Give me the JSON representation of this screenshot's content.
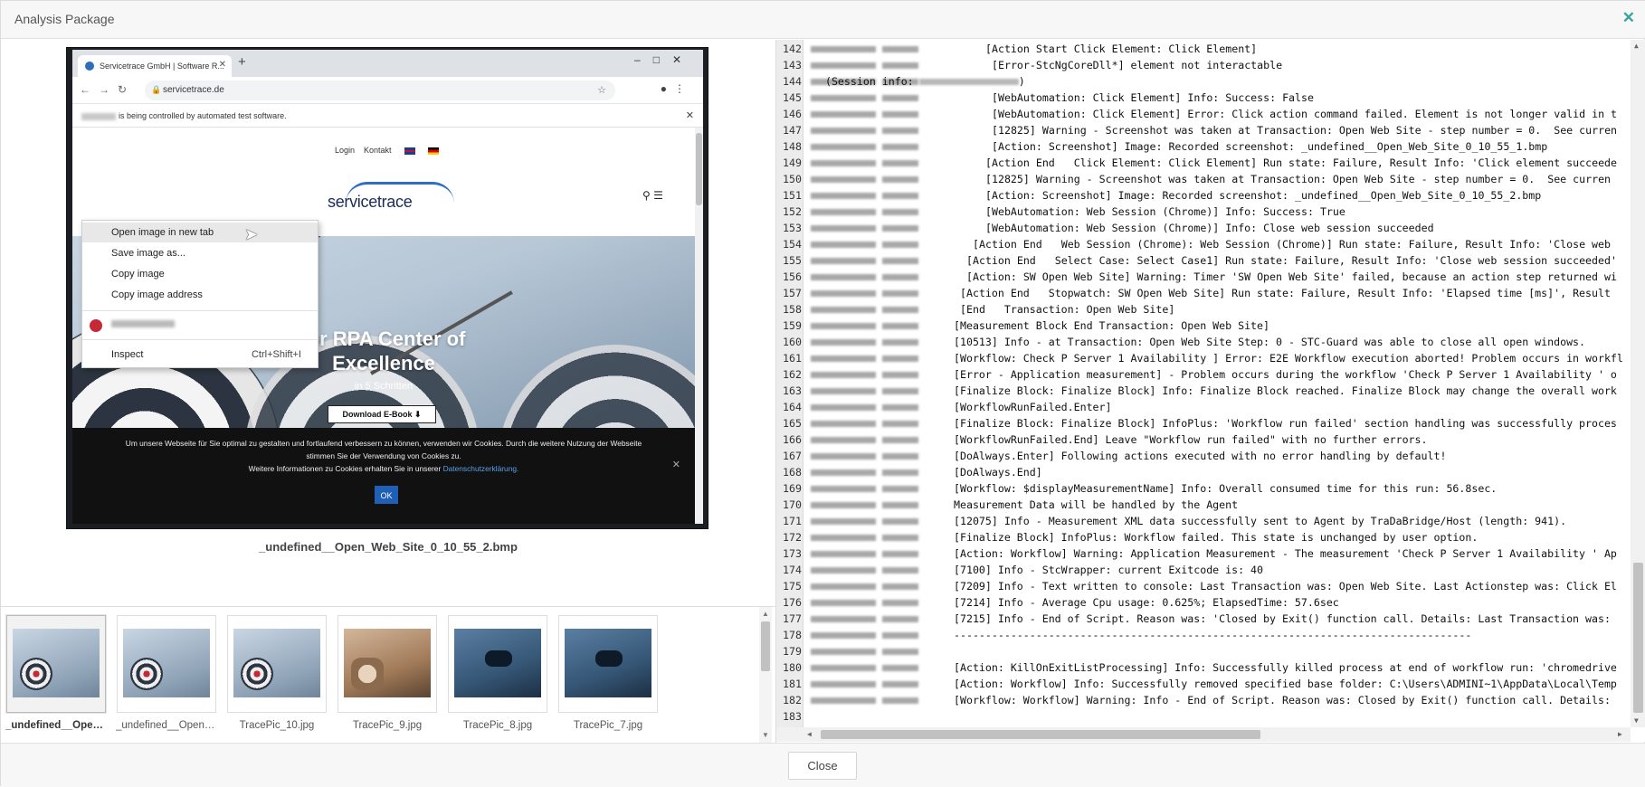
{
  "dialog": {
    "title": "Analysis Package",
    "close_icon": "close-icon",
    "close_button": "Close"
  },
  "preview": {
    "caption": "_undefined__Open_Web_Site_0_10_55_2.bmp",
    "browser": {
      "tab_title": "Servicetrace GmbH | Software R...",
      "url": "servicetrace.de",
      "automation_notice": "is being controlled by automated test software.",
      "site_nav": [
        "Login",
        "Kontakt"
      ],
      "logo": "servicetrace",
      "hero_title_1": "Ihr RPA Center of",
      "hero_title_2": "Excellence",
      "hero_sub": "in 5 Schritten",
      "hero_button": "Download E-Book",
      "cookie_text_1": "Um unsere Webseite für Sie optimal zu gestalten und fortlaufend verbessern zu können, verwenden wir Cookies. Durch die weitere Nutzung der Webseite",
      "cookie_text_2": "stimmen Sie der Verwendung von Cookies zu.",
      "cookie_text_3": "Weitere Informationen zu Cookies erhalten Sie in unserer",
      "cookie_link": "Datenschutzerklärung.",
      "cookie_ok": "OK"
    },
    "context_menu": {
      "items": [
        "Open image in new tab",
        "Save image as...",
        "Copy image",
        "Copy image address"
      ],
      "inspect": "Inspect",
      "inspect_shortcut": "Ctrl+Shift+I"
    }
  },
  "thumbnails": [
    {
      "label": "_undefined__Open_...",
      "style": "target",
      "selected": true
    },
    {
      "label": "_undefined__Open_...",
      "style": "target",
      "selected": false
    },
    {
      "label": "TracePic_10.jpg",
      "style": "target",
      "selected": false
    },
    {
      "label": "TracePic_9.jpg",
      "style": "alt",
      "selected": false
    },
    {
      "label": "TracePic_8.jpg",
      "style": "vr",
      "selected": false
    },
    {
      "label": "TracePic_7.jpg",
      "style": "vr",
      "selected": false
    }
  ],
  "log": {
    "lines": [
      {
        "n": "142",
        "indent": 20,
        "text": "[Action Start Click Element: Click Element]"
      },
      {
        "n": "143",
        "indent": 21,
        "text": "[Error-StcNgCoreDll*] element not interactable"
      },
      {
        "n": "144",
        "indent": 0,
        "text": "  (Session info:",
        "session_blur": true
      },
      {
        "n": "145",
        "indent": 21,
        "text": "[WebAutomation: Click Element] Info: Success: False"
      },
      {
        "n": "146",
        "indent": 21,
        "text": "[WebAutomation: Click Element] Error: Click action command failed. Element is not longer valid in t"
      },
      {
        "n": "147",
        "indent": 21,
        "text": "[12825] Warning - Screenshot was taken at Transaction: Open Web Site - step number = 0.  See curren"
      },
      {
        "n": "148",
        "indent": 21,
        "text": "[Action: Screenshot] Image: Recorded screenshot: _undefined__Open_Web_Site_0_10_55_1.bmp"
      },
      {
        "n": "149",
        "indent": 20,
        "text": "[Action End   Click Element: Click Element] Run state: Failure, Result Info: 'Click element succeede"
      },
      {
        "n": "150",
        "indent": 20,
        "text": "[12825] Warning - Screenshot was taken at Transaction: Open Web Site - step number = 0.  See curren"
      },
      {
        "n": "151",
        "indent": 20,
        "text": "[Action: Screenshot] Image: Recorded screenshot: _undefined__Open_Web_Site_0_10_55_2.bmp"
      },
      {
        "n": "152",
        "indent": 20,
        "text": "[WebAutomation: Web Session (Chrome)] Info: Success: True"
      },
      {
        "n": "153",
        "indent": 20,
        "text": "[WebAutomation: Web Session (Chrome)] Info: Close web session succeeded"
      },
      {
        "n": "154",
        "indent": 18,
        "text": "[Action End   Web Session (Chrome): Web Session (Chrome)] Run state: Failure, Result Info: 'Close web"
      },
      {
        "n": "155",
        "indent": 17,
        "text": "[Action End   Select Case: Select Case1] Run state: Failure, Result Info: 'Close web session succeeded'"
      },
      {
        "n": "156",
        "indent": 17,
        "text": "[Action: SW Open Web Site] Warning: Timer 'SW Open Web Site' failed, because an action step returned wi"
      },
      {
        "n": "157",
        "indent": 16,
        "text": "[Action End   Stopwatch: SW Open Web Site] Run state: Failure, Result Info: 'Elapsed time [ms]', Result"
      },
      {
        "n": "158",
        "indent": 16,
        "text": "[End   Transaction: Open Web Site]"
      },
      {
        "n": "159",
        "indent": 15,
        "text": "[Measurement Block End Transaction: Open Web Site]"
      },
      {
        "n": "160",
        "indent": 15,
        "text": "[10513] Info - at Transaction: Open Web Site Step: 0 - STC-Guard was able to close all open windows."
      },
      {
        "n": "161",
        "indent": 15,
        "text": "[Workflow: Check P Server 1 Availability ] Error: E2E Workflow execution aborted! Problem occurs in workfl"
      },
      {
        "n": "162",
        "indent": 15,
        "text": "[Error - Application measurement] - Problem occurs during the workflow 'Check P Server 1 Availability ' o"
      },
      {
        "n": "163",
        "indent": 15,
        "text": "[Finalize Block: Finalize Block] Info: Finalize Block reached. Finalize Block may change the overall work"
      },
      {
        "n": "164",
        "indent": 15,
        "text": "[WorkflowRunFailed.Enter]"
      },
      {
        "n": "165",
        "indent": 15,
        "text": "[Finalize Block: Finalize Block] InfoPlus: 'Workflow run failed' section handling was successfully proces"
      },
      {
        "n": "166",
        "indent": 15,
        "text": "[WorkflowRunFailed.End] Leave \"Workflow run failed\" with no further errors."
      },
      {
        "n": "167",
        "indent": 15,
        "text": "[DoAlways.Enter] Following actions executed with no error handling by default!"
      },
      {
        "n": "168",
        "indent": 15,
        "text": "[DoAlways.End]"
      },
      {
        "n": "169",
        "indent": 15,
        "text": "[Workflow: $displayMeasurementName] Info: Overall consumed time for this run: 56.8sec."
      },
      {
        "n": "170",
        "indent": 15,
        "text": "Measurement Data will be handled by the Agent"
      },
      {
        "n": "171",
        "indent": 15,
        "text": "[12075] Info - Measurement XML data successfully sent to Agent by TraDaBridge/Host (length: 941)."
      },
      {
        "n": "172",
        "indent": 15,
        "text": "[Finalize Block] InfoPlus: Workflow failed. This state is unchanged by user option."
      },
      {
        "n": "173",
        "indent": 15,
        "text": "[Action: Workflow] Warning: Application Measurement - The measurement 'Check P Server 1 Availability ' Ap"
      },
      {
        "n": "174",
        "indent": 15,
        "text": "[7100] Info - StcWrapper: current Exitcode is: 40"
      },
      {
        "n": "175",
        "indent": 15,
        "text": "[7209] Info - Text written to console: Last Transaction was: Open Web Site. Last Actionstep was: Click El"
      },
      {
        "n": "176",
        "indent": 15,
        "text": "[7214] Info - Average Cpu usage: 0.625%; ElapsedTime: 57.6sec"
      },
      {
        "n": "177",
        "indent": 15,
        "text": "[7215] Info - End of Script. Reason was: 'Closed by Exit() function call. Details: Last Transaction was:"
      },
      {
        "n": "178",
        "indent": 15,
        "text": "----------------------------------------------------------------------------------"
      },
      {
        "n": "179",
        "indent": 15,
        "text": ""
      },
      {
        "n": "180",
        "indent": 15,
        "text": "[Action: KillOnExitListProcessing] Info: Successfully killed process at end of workflow run: 'chromedrive"
      },
      {
        "n": "181",
        "indent": 15,
        "text": "[Action: Workflow] Info: Successfully removed specified base folder: C:\\Users\\ADMINI~1\\AppData\\Local\\Temp"
      },
      {
        "n": "182",
        "indent": 15,
        "text": "[Workflow: Workflow] Warning: Info - End of Script. Reason was: Closed by Exit() function call. Details:"
      },
      {
        "n": "183",
        "indent": 0,
        "text": "",
        "no_blur": true
      }
    ]
  }
}
